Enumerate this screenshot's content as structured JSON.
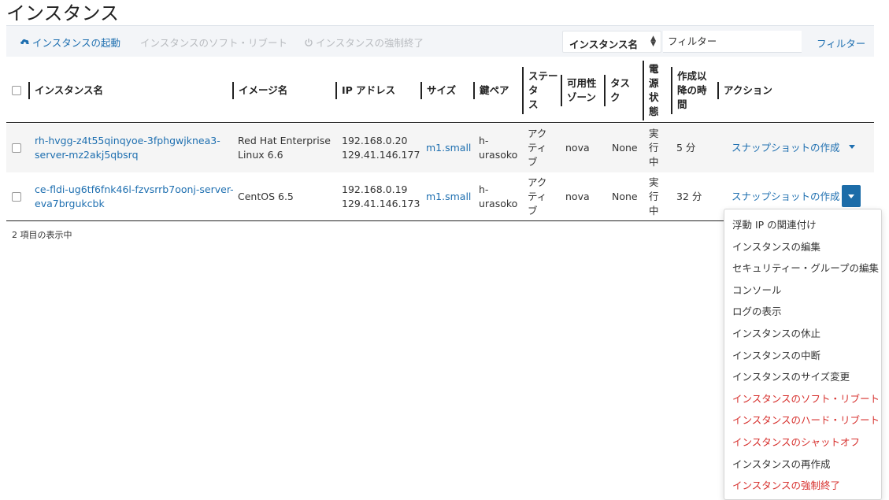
{
  "page": {
    "title": "インスタンス"
  },
  "toolbar": {
    "launch_label": "インスタンスの起動",
    "soft_reboot_label": "インスタンスのソフト・リブート",
    "terminate_label": "インスタンスの強制終了",
    "filter_column": "インスタンス名",
    "filter_placeholder": "フィルター",
    "filter_button": "フィルター"
  },
  "colors": {
    "link": "#1e6fb0",
    "danger": "#d7322f",
    "primary_button": "#1c6ca8"
  },
  "table": {
    "headers": {
      "name": "インスタンス名",
      "image": "イメージ名",
      "ip": "IP アドレス",
      "size": "サイズ",
      "keypair": "鍵ペア",
      "status_l1": "ステー",
      "status_l2": "タ",
      "status_l3": "ス",
      "az_l1": "可用性",
      "az_l2": "ゾーン",
      "task_l1": "タス",
      "task_l2": "ク",
      "power_l1": "電",
      "power_l2": "源",
      "power_l3": "状",
      "power_l4": "態",
      "age_l1": "作成以",
      "age_l2": "降の時",
      "age_l3": "間",
      "actions": "アクション"
    },
    "rows": [
      {
        "name_l1": "rh-hvgg-z4t55qinqyoe-3fphgwjknea3-",
        "name_l2": "server-mz2akj5qbsrq",
        "image_l1": "Red Hat Enterprise",
        "image_l2": "Linux 6.6",
        "ip_l1": "192.168.0.20",
        "ip_l2": "129.41.146.177",
        "size": "m1.small",
        "key_l1": "h-",
        "key_l2": "urasoko",
        "status_l1": "アク",
        "status_l2": "ティ",
        "status_l3": "ブ",
        "az": "nova",
        "task": "None",
        "power_l1": "実",
        "power_l2": "行",
        "power_l3": "中",
        "age": "5 分",
        "action": "スナップショットの作成"
      },
      {
        "name_l1": "ce-fldi-ug6tf6fnk46l-fzvsrrb7oonj-server-",
        "name_l2": "eva7brgukcbk",
        "image_l1": "CentOS 6.5",
        "image_l2": "",
        "ip_l1": "192.168.0.19",
        "ip_l2": "129.41.146.173",
        "size": "m1.small",
        "key_l1": "h-",
        "key_l2": "urasoko",
        "status_l1": "アク",
        "status_l2": "ティ",
        "status_l3": "ブ",
        "az": "nova",
        "task": "None",
        "power_l1": "実",
        "power_l2": "行",
        "power_l3": "中",
        "age": "32 分",
        "action": "スナップショットの作成"
      }
    ],
    "count_text": "2 項目の表示中"
  },
  "dropdown": {
    "items": [
      {
        "label": "浮動 IP の関連付け",
        "danger": false
      },
      {
        "label": "インスタンスの編集",
        "danger": false
      },
      {
        "label": "セキュリティー・グループの編集",
        "danger": false
      },
      {
        "label": "コンソール",
        "danger": false
      },
      {
        "label": "ログの表示",
        "danger": false
      },
      {
        "label": "インスタンスの休止",
        "danger": false
      },
      {
        "label": "インスタンスの中断",
        "danger": false
      },
      {
        "label": "インスタンスのサイズ変更",
        "danger": false
      },
      {
        "label": "インスタンスのソフト・リブート",
        "danger": true
      },
      {
        "label": "インスタンスのハード・リブート",
        "danger": true
      },
      {
        "label": "インスタンスのシャットオフ",
        "danger": true
      },
      {
        "label": "インスタンスの再作成",
        "danger": false
      },
      {
        "label": "インスタンスの強制終了",
        "danger": true
      }
    ]
  }
}
